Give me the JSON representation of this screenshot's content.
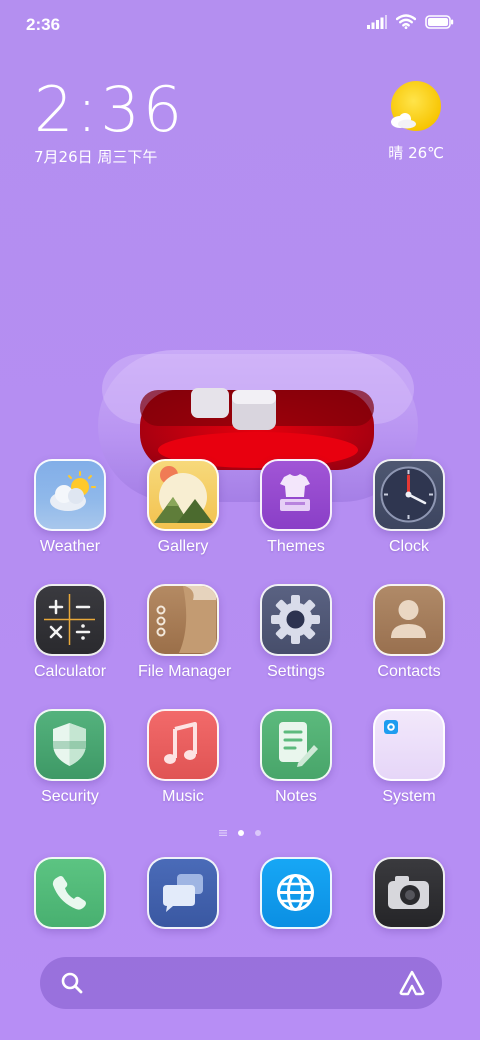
{
  "status_bar": {
    "time": "2:36",
    "icons": [
      "signal-icon",
      "wifi-icon",
      "battery-icon"
    ]
  },
  "clock_widget": {
    "time": "2:36",
    "date": "7月26日 周三下午"
  },
  "weather_widget": {
    "condition_icon": "sun-cloud-icon",
    "text": "晴 26℃"
  },
  "apps": [
    {
      "label": "Weather",
      "icon": "weather-icon"
    },
    {
      "label": "Gallery",
      "icon": "gallery-icon"
    },
    {
      "label": "Themes",
      "icon": "themes-icon"
    },
    {
      "label": "Clock",
      "icon": "clock-icon"
    },
    {
      "label": "Calculator",
      "icon": "calculator-icon"
    },
    {
      "label": "File Manager",
      "icon": "file-manager-icon"
    },
    {
      "label": "Settings",
      "icon": "settings-icon"
    },
    {
      "label": "Contacts",
      "icon": "contacts-icon"
    },
    {
      "label": "Security",
      "icon": "security-icon"
    },
    {
      "label": "Music",
      "icon": "music-icon"
    },
    {
      "label": "Notes",
      "icon": "notes-icon"
    },
    {
      "label": "System",
      "icon": "system-folder-icon"
    }
  ],
  "page_indicator": {
    "pages": 2,
    "active": 1
  },
  "dock": [
    {
      "icon": "phone-icon"
    },
    {
      "icon": "messages-icon"
    },
    {
      "icon": "browser-icon"
    },
    {
      "icon": "camera-icon"
    }
  ],
  "search_bar": {
    "left_icon": "search-icon",
    "right_icon": "assistant-icon"
  },
  "colors": {
    "wallpaper": "#b58ef2",
    "sun": "#ffd21a",
    "search_bar": "#9a6fd6"
  }
}
